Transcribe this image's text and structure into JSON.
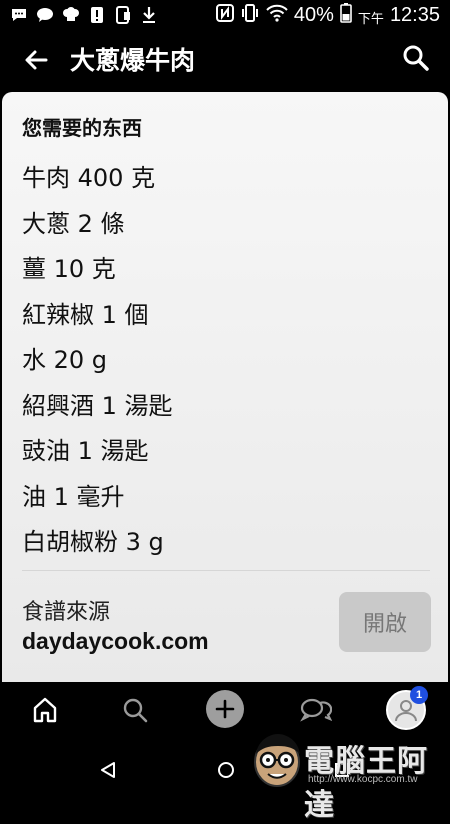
{
  "status_bar": {
    "battery_percent": "40%",
    "time_prefix": "下午",
    "time": "12:35",
    "icons": [
      "message-icon",
      "chat-icon",
      "chef-hat-icon",
      "alert-icon",
      "phone-icon",
      "download-icon",
      "nfc-icon",
      "vibrate-icon",
      "wifi-icon",
      "battery-icon"
    ]
  },
  "app_bar": {
    "title": "大蔥爆牛肉",
    "back_icon": "arrow-back-icon",
    "search_icon": "search-icon"
  },
  "card": {
    "header": "您需要的东西",
    "ingredients": [
      "牛肉 400 克",
      "大蔥 2 條",
      "薑 10 克",
      "紅辣椒 1 個",
      "水 20 g",
      "紹興酒 1 湯匙",
      "豉油 1 湯匙",
      "油 1 毫升",
      "白胡椒粉 3 g"
    ],
    "source_label": "食譜來源",
    "source_site": "daydaycook.com",
    "open_button_label": "開啟"
  },
  "bottom_nav": {
    "items": [
      "home-icon",
      "search-icon",
      "add-icon",
      "messages-icon",
      "profile-icon"
    ],
    "badge_count": "1"
  },
  "watermark": {
    "text": "電腦王阿達",
    "url": "http://www.kocpc.com.tw"
  },
  "colors": {
    "background": "#000000",
    "card": "#f2f2f2",
    "button_disabled": "#c9c9c9",
    "badge": "#1f4fe0"
  }
}
